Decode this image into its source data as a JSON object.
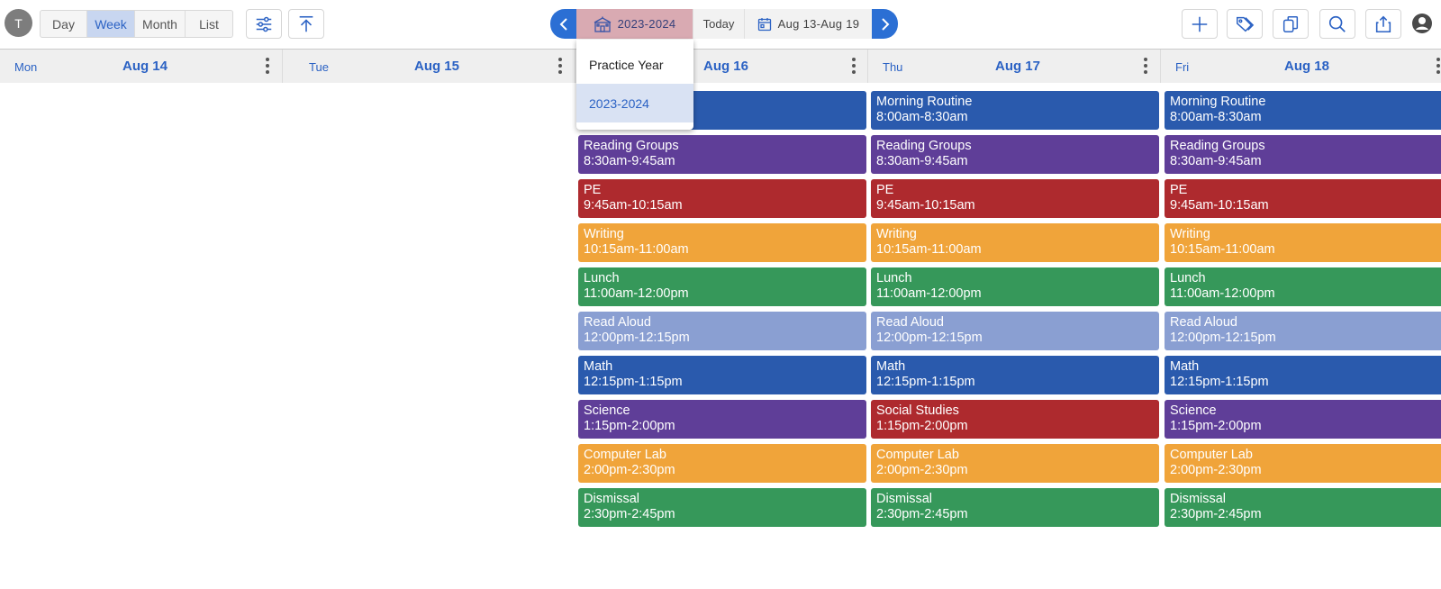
{
  "user_initial": "T",
  "view_tabs": [
    "Day",
    "Week",
    "Month",
    "List"
  ],
  "active_view": "Week",
  "nav": {
    "year": "2023-2024",
    "today": "Today",
    "range": "Aug 13-Aug 19"
  },
  "year_dropdown": {
    "options": [
      "Practice Year",
      "2023-2024"
    ],
    "selected": "2023-2024"
  },
  "days": [
    {
      "name": "Mon",
      "date": "Aug 14"
    },
    {
      "name": "Tue",
      "date": "Aug 15"
    },
    {
      "name": "",
      "date": "Aug 16"
    },
    {
      "name": "Thu",
      "date": "Aug 17"
    },
    {
      "name": "Fri",
      "date": "Aug 18"
    }
  ],
  "colors": {
    "blue": "#2a5aad",
    "purple": "#5f3e98",
    "red": "#ae2a2e",
    "orange": "#f0a43a",
    "green": "#36985a",
    "light_blue": "#8a9fd2",
    "accent": "#2b6fd4"
  },
  "events": {
    "wed": [
      {
        "title": "",
        "time": "",
        "color": "blue"
      },
      {
        "title": "Reading Groups",
        "time": "8:30am-9:45am",
        "color": "purple"
      },
      {
        "title": "PE",
        "time": "9:45am-10:15am",
        "color": "red"
      },
      {
        "title": "Writing",
        "time": "10:15am-11:00am",
        "color": "orange"
      },
      {
        "title": "Lunch",
        "time": "11:00am-12:00pm",
        "color": "green"
      },
      {
        "title": "Read Aloud",
        "time": "12:00pm-12:15pm",
        "color": "light_blue"
      },
      {
        "title": "Math",
        "time": "12:15pm-1:15pm",
        "color": "blue"
      },
      {
        "title": "Science",
        "time": "1:15pm-2:00pm",
        "color": "purple"
      },
      {
        "title": "Computer Lab",
        "time": "2:00pm-2:30pm",
        "color": "orange"
      },
      {
        "title": "Dismissal",
        "time": "2:30pm-2:45pm",
        "color": "green"
      }
    ],
    "thu": [
      {
        "title": "Morning Routine",
        "time": "8:00am-8:30am",
        "color": "blue"
      },
      {
        "title": "Reading Groups",
        "time": "8:30am-9:45am",
        "color": "purple"
      },
      {
        "title": "PE",
        "time": "9:45am-10:15am",
        "color": "red"
      },
      {
        "title": "Writing",
        "time": "10:15am-11:00am",
        "color": "orange"
      },
      {
        "title": "Lunch",
        "time": "11:00am-12:00pm",
        "color": "green"
      },
      {
        "title": "Read Aloud",
        "time": "12:00pm-12:15pm",
        "color": "light_blue"
      },
      {
        "title": "Math",
        "time": "12:15pm-1:15pm",
        "color": "blue"
      },
      {
        "title": "Social Studies",
        "time": "1:15pm-2:00pm",
        "color": "red"
      },
      {
        "title": "Computer Lab",
        "time": "2:00pm-2:30pm",
        "color": "orange"
      },
      {
        "title": "Dismissal",
        "time": "2:30pm-2:45pm",
        "color": "green"
      }
    ],
    "fri": [
      {
        "title": "Morning Routine",
        "time": "8:00am-8:30am",
        "color": "blue"
      },
      {
        "title": "Reading Groups",
        "time": "8:30am-9:45am",
        "color": "purple"
      },
      {
        "title": "PE",
        "time": "9:45am-10:15am",
        "color": "red"
      },
      {
        "title": "Writing",
        "time": "10:15am-11:00am",
        "color": "orange"
      },
      {
        "title": "Lunch",
        "time": "11:00am-12:00pm",
        "color": "green"
      },
      {
        "title": "Read Aloud",
        "time": "12:00pm-12:15pm",
        "color": "light_blue"
      },
      {
        "title": "Math",
        "time": "12:15pm-1:15pm",
        "color": "blue"
      },
      {
        "title": "Science",
        "time": "1:15pm-2:00pm",
        "color": "purple"
      },
      {
        "title": "Computer Lab",
        "time": "2:00pm-2:30pm",
        "color": "orange"
      },
      {
        "title": "Dismissal",
        "time": "2:30pm-2:45pm",
        "color": "green"
      }
    ]
  }
}
